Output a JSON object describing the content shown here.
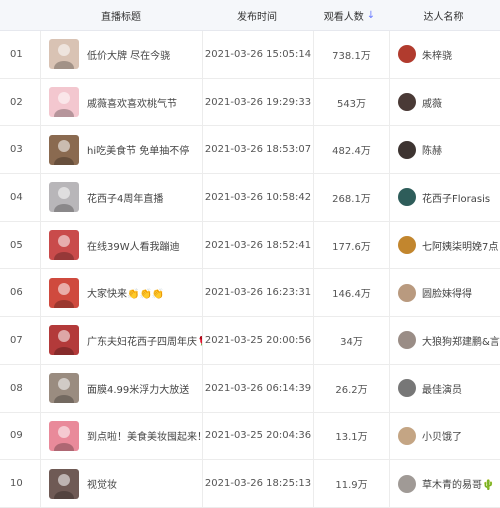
{
  "header": {
    "title_col": "直播标题",
    "time_col": "发布时间",
    "views_col": "观看人数",
    "sort_icon": "↓",
    "host_col": "达人名称"
  },
  "rows": [
    {
      "idx": "01",
      "title": "低价大牌 尽在今骁",
      "time": "2021-03-26 15:05:14",
      "views": "738.1万",
      "host": "朱梓骁",
      "thumb_color": "#d9c3b4",
      "avatar_color": "#b13b2e"
    },
    {
      "idx": "02",
      "title": "戚薇喜欢喜欢桃气节",
      "time": "2021-03-26 19:29:33",
      "views": "543万",
      "host": "戚薇",
      "thumb_color": "#f3c7cf",
      "avatar_color": "#4a3a36"
    },
    {
      "idx": "03",
      "title": "hi吃美食节 免单抽不停",
      "time": "2021-03-26 18:53:07",
      "views": "482.4万",
      "host": "陈赫",
      "thumb_color": "#8a6a50",
      "avatar_color": "#3d3431"
    },
    {
      "idx": "04",
      "title": "花西子4周年直播",
      "time": "2021-03-26 10:58:42",
      "views": "268.1万",
      "host": "花西子Florasis",
      "thumb_color": "#b8b6b9",
      "avatar_color": "#2e5d5a"
    },
    {
      "idx": "05",
      "title": "在线39W人看我蹦迪",
      "time": "2021-03-26 18:52:41",
      "views": "177.6万",
      "host": "七阿姨柒明娩7点",
      "thumb_color": "#c94b4b",
      "avatar_color": "#c2862e"
    },
    {
      "idx": "06",
      "title": "大家快来👏👏👏",
      "time": "2021-03-26 16:23:31",
      "views": "146.4万",
      "host": "圆脸妹得得",
      "thumb_color": "#cf4a3e",
      "avatar_color": "#b99a7f"
    },
    {
      "idx": "07",
      "title": "广东夫妇花西子四周年庆🌹",
      "time": "2021-03-25 20:00:56",
      "views": "34万",
      "host": "大狼狗郑建鹏&言",
      "thumb_color": "#b33a3a",
      "avatar_color": "#9a8d86"
    },
    {
      "idx": "08",
      "title": "面膜4.99米浮力大放送",
      "time": "2021-03-26 06:14:39",
      "views": "26.2万",
      "host": "最佳演员",
      "thumb_color": "#9a8c80",
      "avatar_color": "#777777"
    },
    {
      "idx": "09",
      "title": "到点啦！美食美妆囤起来！",
      "time": "2021-03-25 20:04:36",
      "views": "13.1万",
      "host": "小贝饿了",
      "thumb_color": "#e98a9a",
      "avatar_color": "#c4a584"
    },
    {
      "idx": "10",
      "title": "视觉妆",
      "time": "2021-03-26 18:25:13",
      "views": "11.9万",
      "host": "草木青的易哥🌵",
      "thumb_color": "#6f5a55",
      "avatar_color": "#a09a96"
    }
  ]
}
